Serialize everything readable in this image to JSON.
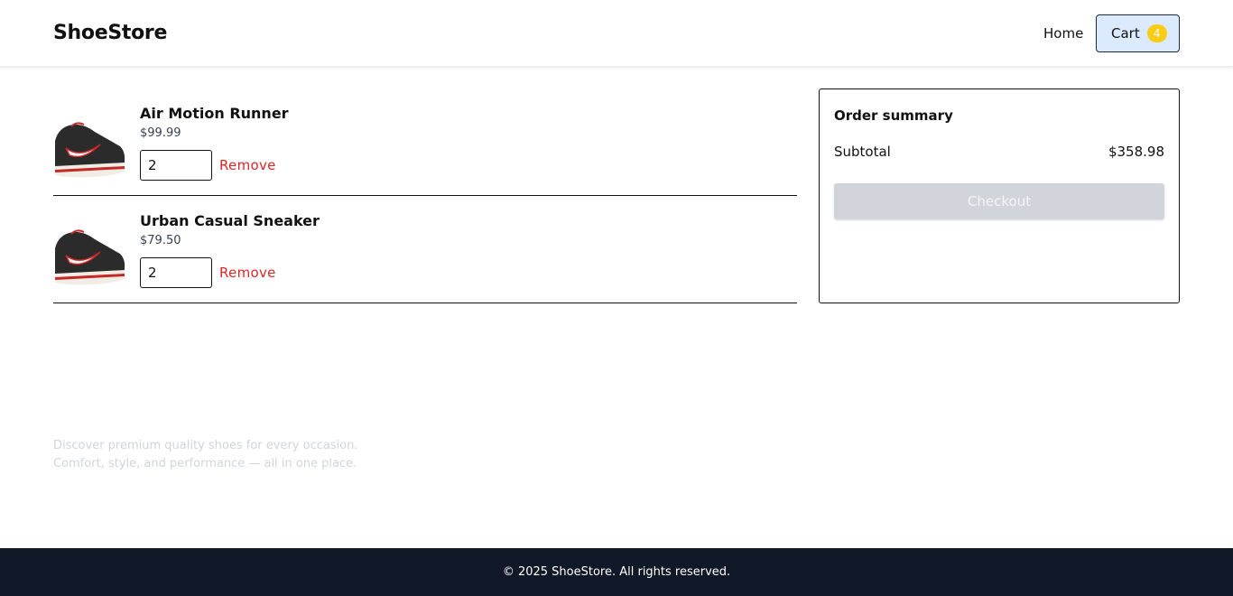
{
  "header": {
    "brand": "ShoeStore",
    "nav": {
      "home_label": "Home",
      "cart_label": "Cart",
      "cart_count": "4"
    }
  },
  "cart": {
    "items": [
      {
        "name": "Air Motion Runner",
        "price": "$99.99",
        "quantity": "2",
        "remove_label": "Remove",
        "image": "sneaker-image"
      },
      {
        "name": "Urban Casual Sneaker",
        "price": "$79.50",
        "quantity": "2",
        "remove_label": "Remove",
        "image": "sneaker-image"
      }
    ]
  },
  "summary": {
    "title": "Order summary",
    "subtotal_label": "Subtotal",
    "subtotal_value": "$358.98",
    "checkout_label": "Checkout"
  },
  "tagline": "Discover premium quality shoes for every occasion. Comfort, style, and performance — all in one place.",
  "footer": {
    "text": "© 2025 ShoeStore. All rights reserved."
  },
  "colors": {
    "cart_button_bg": "#dbeafe",
    "badge": "#facc15",
    "remove": "#dc2626",
    "checkout_disabled": "#d1d5db",
    "footer_bg": "#111827"
  }
}
